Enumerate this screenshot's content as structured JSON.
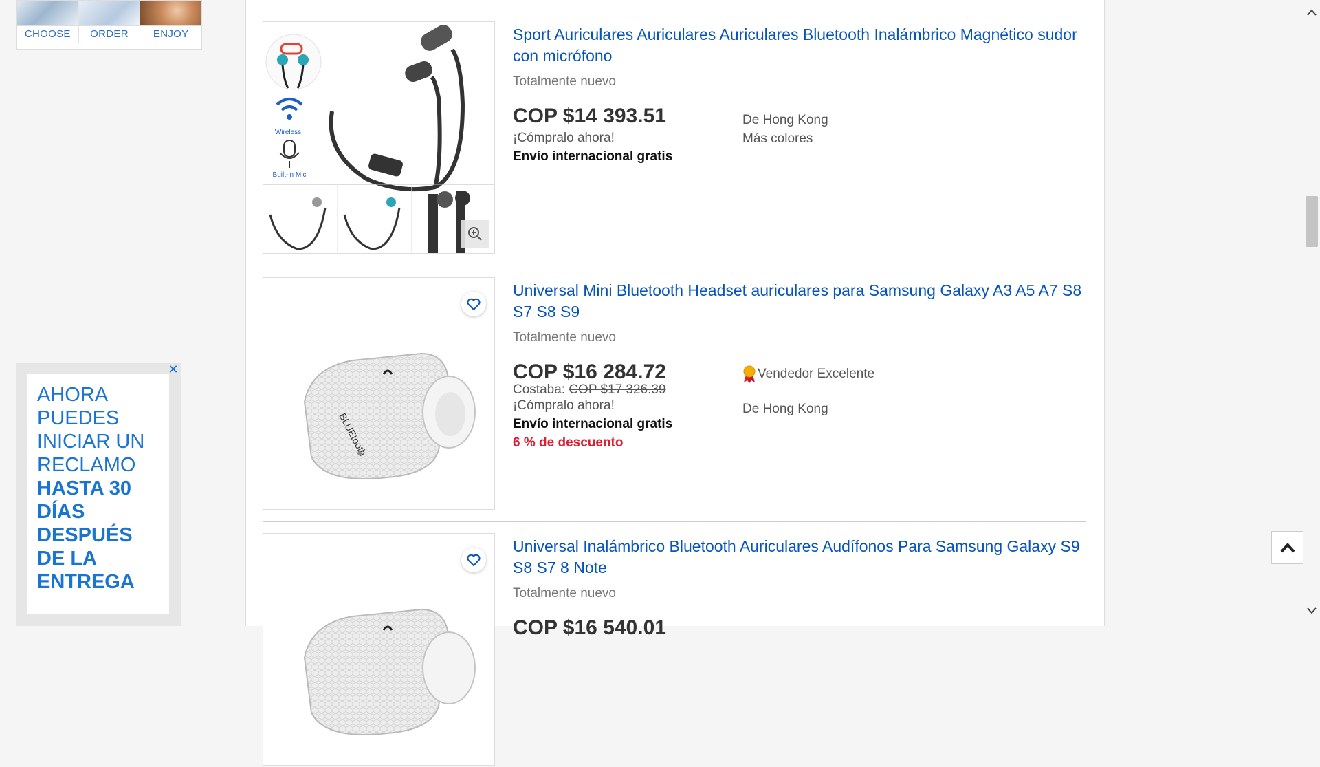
{
  "left_ad_top": {
    "steps": [
      "CHOOSE",
      "ORDER",
      "ENJOY"
    ]
  },
  "left_ad_bottom": {
    "close_glyph": "✕",
    "line1": "AHORA PUEDES INICIAR UN RECLAMO",
    "line2": "HASTA 30 DÍAS DESPUÉS DE LA ENTREGA"
  },
  "items": [
    {
      "title": "Sport Auriculares Auriculares Auriculares Bluetooth Inalámbrico Magnético sudor con micrófono",
      "condition": "Totalmente nuevo",
      "price": "COP $14 393.51",
      "buy_now": "¡Cómpralo ahora!",
      "shipping": "Envío internacional gratis",
      "origin": "De Hong Kong",
      "more_colors": "Más colores",
      "image_labels": {
        "wireless": "Wireless",
        "mic": "Built-in Mic"
      }
    },
    {
      "title": "Universal Mini Bluetooth Headset auriculares para Samsung Galaxy A3 A5 A7 S8 S7 S8 S9",
      "condition": "Totalmente nuevo",
      "price": "COP $16 284.72",
      "was_label": "Costaba:",
      "was_price": "COP $17 326.39",
      "buy_now": "¡Cómpralo ahora!",
      "shipping": "Envío internacional gratis",
      "discount": "6 % de descuento",
      "seller": "Vendedor Excelente",
      "origin": "De Hong Kong",
      "image_text": "BLUEtooth"
    },
    {
      "title": "Universal Inalámbrico Bluetooth Auriculares Audífonos Para Samsung Galaxy S9 S8 S7 8 Note",
      "condition": "Totalmente nuevo",
      "price_partial": "COP $16 540.01"
    }
  ],
  "icons": {
    "heart": "heart-icon",
    "zoom": "zoom-in-icon",
    "back_to_top": "chevron-up-icon"
  },
  "colors": {
    "link": "#0654ba",
    "discount": "#dd1e31",
    "ad_blue": "#1a75d2"
  }
}
